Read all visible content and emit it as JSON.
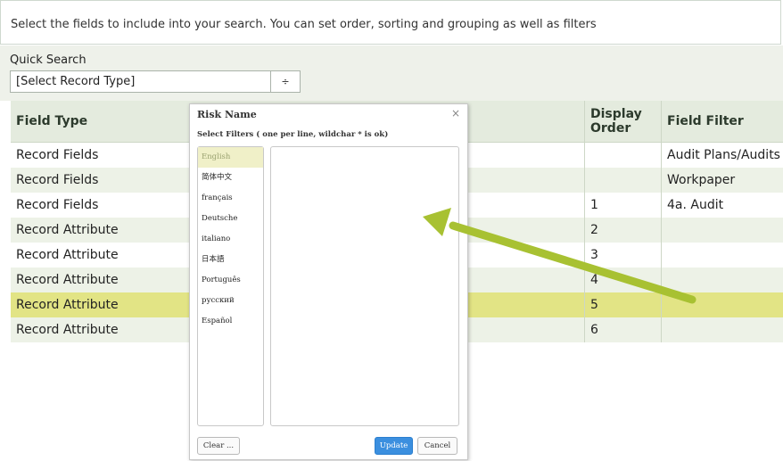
{
  "intro": {
    "text": "Select the fields to include into your search. You can set order, sorting and grouping as well as filters"
  },
  "quick_search": {
    "label": "Quick Search",
    "selected": "[Select Record Type]",
    "arrow": "÷"
  },
  "table": {
    "headers": {
      "field_type": "Field Type",
      "display_order": "Display Order",
      "field_filter": "Field Filter"
    },
    "rows": [
      {
        "field_type": "Record Fields",
        "display_order": "",
        "field_filter": "Audit Plans/Audits"
      },
      {
        "field_type": "Record Fields",
        "display_order": "",
        "field_filter": "Workpaper"
      },
      {
        "field_type": "Record Fields",
        "display_order": "1",
        "field_filter": "4a. Audit"
      },
      {
        "field_type": "Record Attribute",
        "display_order": "2",
        "field_filter": ""
      },
      {
        "field_type": "Record Attribute",
        "display_order": "3",
        "field_filter": ""
      },
      {
        "field_type": "Record Attribute",
        "display_order": "4",
        "field_filter": ""
      },
      {
        "field_type": "Record Attribute",
        "display_order": "5",
        "field_filter": ""
      },
      {
        "field_type": "Record Attribute",
        "display_order": "6",
        "field_filter": ""
      }
    ]
  },
  "popup": {
    "title": "Risk Name",
    "close": "×",
    "subtitle": "Select Filters ( one per line, wildchar * is ok)",
    "languages": [
      "English",
      "简体中文",
      "français",
      "Deutsche",
      "italiano",
      "日本語",
      "Português",
      "русский",
      "Español"
    ],
    "filter_value": "",
    "clear_label": "Clear ...",
    "update_label": "Update",
    "cancel_label": "Cancel"
  },
  "colors": {
    "selected_row": "#e2e485",
    "arrow": "#a8c132",
    "update_button": "#3b8fdf"
  }
}
